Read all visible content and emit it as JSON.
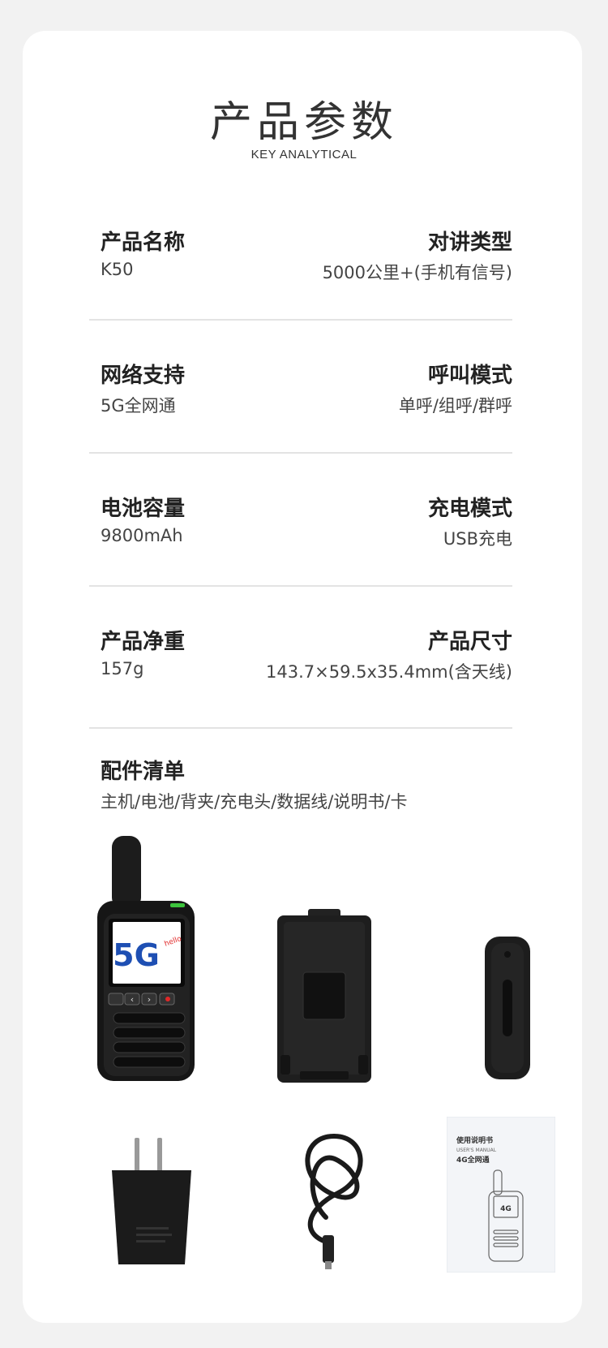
{
  "header": {
    "title": "产品参数",
    "subtitle": "KEY ANALYTICAL"
  },
  "specs": [
    {
      "left_label": "产品名称",
      "left_value": "K50",
      "right_label": "对讲类型",
      "right_value": "5000公里+(手机有信号)"
    },
    {
      "left_label": "网络支持",
      "left_value": "5G全网通",
      "right_label": "呼叫模式",
      "right_value": "单呼/组呼/群呼"
    },
    {
      "left_label": "电池容量",
      "left_value": "9800mAh",
      "right_label": "充电模式",
      "right_value": "USB充电"
    },
    {
      "left_label": "产品净重",
      "left_value": "157g",
      "right_label": "产品尺寸",
      "right_value": "143.7×59.5x35.4mm(含天线)"
    }
  ],
  "accessories": {
    "title": "配件清单",
    "list": "主机/电池/背夹/充电头/数据线/说明书/卡"
  },
  "screen_logo": {
    "text": "5G",
    "hello": "hello"
  },
  "manual": {
    "title": "使用说明书",
    "subtitle": "USER'S MANUAL",
    "network": "4G全网通",
    "logo": "4G"
  },
  "colors": {
    "page_bg": "#f2f2f2",
    "card_bg": "#ffffff",
    "divider": "#e3e3e3",
    "logo_blue": "#1e4fb3",
    "logo_red": "#e02828"
  }
}
